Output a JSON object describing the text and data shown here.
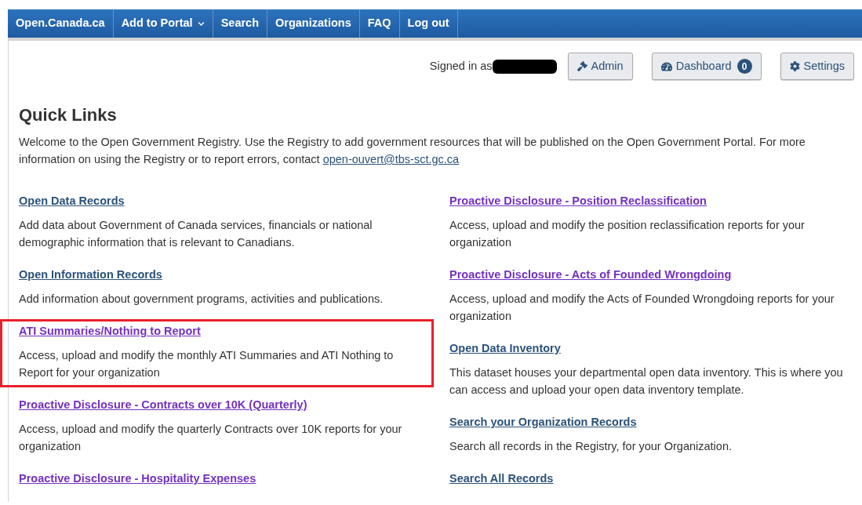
{
  "nav": [
    {
      "label": "Open.Canada.ca",
      "dropdown": false
    },
    {
      "label": "Add to Portal",
      "dropdown": true
    },
    {
      "label": "Search",
      "dropdown": false
    },
    {
      "label": "Organizations",
      "dropdown": false
    },
    {
      "label": "FAQ",
      "dropdown": false
    },
    {
      "label": "Log out",
      "dropdown": false
    }
  ],
  "account": {
    "signed_in_label": "Signed in as",
    "username_redacted": true,
    "buttons": [
      {
        "kind": "admin",
        "label": "Admin"
      },
      {
        "kind": "dashboard",
        "label": "Dashboard",
        "count": "0"
      },
      {
        "kind": "settings",
        "label": "Settings"
      }
    ]
  },
  "title": "Quick Links",
  "intro": "Welcome to the Open Government Registry. Use the Registry to add government resources that will be published on the Open Government Portal. For more information on using the Registry or to report errors, contact",
  "intro_link": "open-ouvert@tbs-sct.gc.ca",
  "columns": [
    [
      {
        "title": "Open Data Records",
        "visited": false,
        "highlighted": false,
        "description": "Add data about Government of Canada services, financials or national demographic information that is relevant to Canadians."
      },
      {
        "title": "Open Information Records",
        "visited": false,
        "highlighted": false,
        "description": "Add information about government programs, activities and publications."
      },
      {
        "title": "ATI Summaries/Nothing to Report",
        "visited": true,
        "highlighted": true,
        "description": "Access, upload and modify the monthly ATI Summaries and ATI Nothing to Report for your organization"
      },
      {
        "title": "Proactive Disclosure - Contracts over 10K (Quarterly)",
        "visited": true,
        "highlighted": false,
        "description": "Access, upload and modify the quarterly Contracts over 10K reports for your organization"
      },
      {
        "title": "Proactive Disclosure - Hospitality Expenses",
        "visited": true,
        "highlighted": false
      }
    ],
    [
      {
        "title": "Proactive Disclosure - Position Reclassification",
        "visited": true,
        "highlighted": false,
        "description": "Access, upload and modify the position reclassification reports for your organization"
      },
      {
        "title": "Proactive Disclosure - Acts of Founded Wrongdoing",
        "visited": true,
        "highlighted": false,
        "description": "Access, upload and modify the Acts of Founded Wrongdoing reports for your organization"
      },
      {
        "title": "Open Data Inventory",
        "visited": false,
        "highlighted": false,
        "description": "This dataset houses your departmental open data inventory. This is where you can access and upload your open data inventory template."
      },
      {
        "title": "Search your Organization Records",
        "visited": false,
        "highlighted": false,
        "description": "Search all records in the Registry, for your Organization."
      },
      {
        "title": "Search All Records",
        "visited": false,
        "highlighted": false
      }
    ]
  ]
}
